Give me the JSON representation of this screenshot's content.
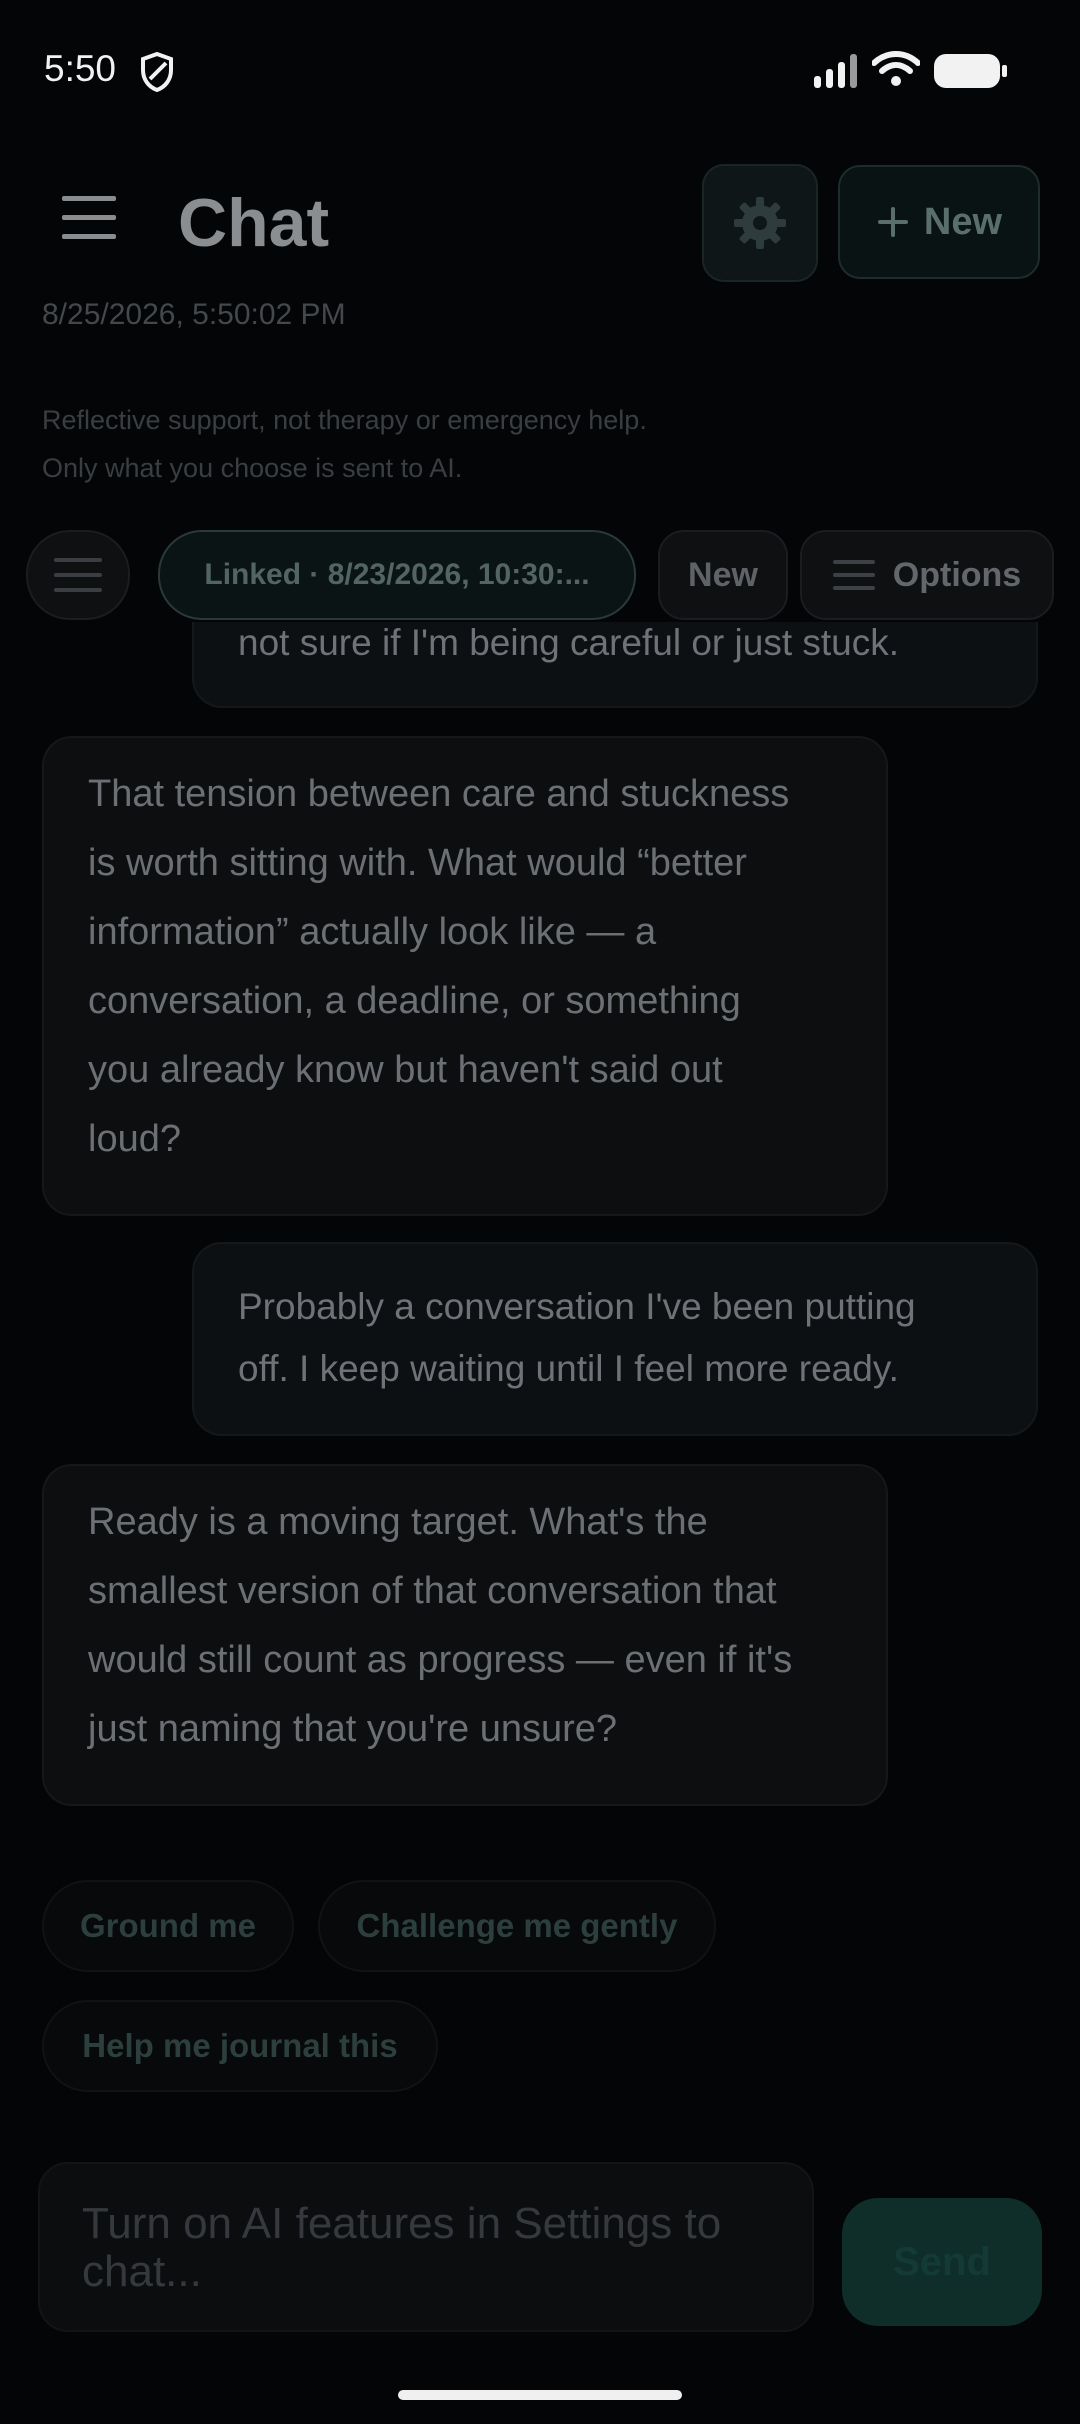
{
  "status": {
    "time": "5:50"
  },
  "header": {
    "title": "Chat",
    "new_label": "New",
    "timestamp": "8/25/2026, 5:50:02 PM",
    "disclaimer_line1": "Reflective support, not therapy or emergency help.",
    "disclaimer_line2": "Only what you choose is sent to AI."
  },
  "toolbar": {
    "linked_label": "Linked · 8/23/2026, 10:30:...",
    "new_label": "New",
    "options_label": "Options"
  },
  "messages": [
    {
      "role": "user",
      "text": "not sure if I'm being careful or just stuck."
    },
    {
      "role": "assistant",
      "lines": [
        "That tension between care and stuckness",
        "is worth sitting with. What would “better",
        "information” actually look like — a",
        "conversation, a deadline, or something",
        "you already know but haven't said out",
        "loud?"
      ]
    },
    {
      "role": "user",
      "lines": [
        "Probably a conversation I've been putting",
        "off. I keep waiting until I feel more ready."
      ]
    },
    {
      "role": "assistant",
      "lines": [
        "Ready is a moving target. What's the",
        "smallest version of that conversation that",
        "would still count as progress — even if it's",
        "just naming that you're unsure?"
      ]
    }
  ],
  "suggestions": [
    "Ground me",
    "Challenge me gently",
    "Help me journal this"
  ],
  "composer": {
    "placeholder_line1": "Turn on AI features in Settings to",
    "placeholder_line2": "chat...",
    "send_label": "Send"
  },
  "colors": {
    "accent": "#0f2e29",
    "background": "#040506"
  }
}
